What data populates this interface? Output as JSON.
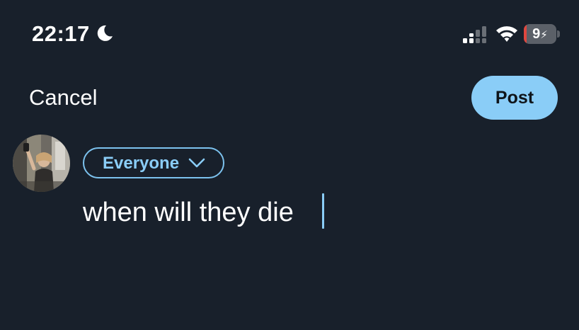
{
  "status_bar": {
    "time": "22:17",
    "moon_icon": "moon-icon",
    "signal_icon": "cellular-signal-icon",
    "wifi_icon": "wifi-icon",
    "battery_level": "9",
    "battery_fraction": 0.09,
    "charging_glyph": "⚡",
    "battery_icon": "battery-charging-icon"
  },
  "header": {
    "cancel_label": "Cancel",
    "post_label": "Post"
  },
  "compose": {
    "avatar_icon": "user-avatar",
    "audience_label": "Everyone",
    "audience_chevron_icon": "chevron-down-icon",
    "text_value": "when will they die"
  },
  "colors": {
    "background": "#18202b",
    "accent": "#8acdf7",
    "battery_low": "#e0473f"
  }
}
